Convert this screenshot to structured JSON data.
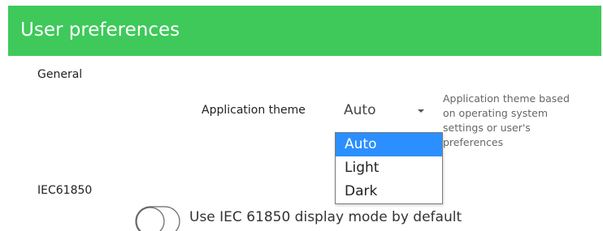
{
  "header": {
    "title": "User preferences",
    "background_color": "#3ec95a"
  },
  "general": {
    "section_title": "General",
    "theme": {
      "label": "Application theme",
      "selected_value": "Auto",
      "arrow_icon": "caret-down-icon",
      "help_lines": [
        "Application theme based",
        "on operating system",
        "settings or user's",
        "preferences"
      ],
      "options": [
        "Auto",
        "Light",
        "Dark"
      ],
      "highlighted_option": "Auto",
      "highlight_color": "#2b8fff"
    }
  },
  "iec61850": {
    "section_title": "IEC61850",
    "display_mode_toggle": {
      "label": "Use IEC 61850 display mode by default",
      "checked": false
    }
  }
}
